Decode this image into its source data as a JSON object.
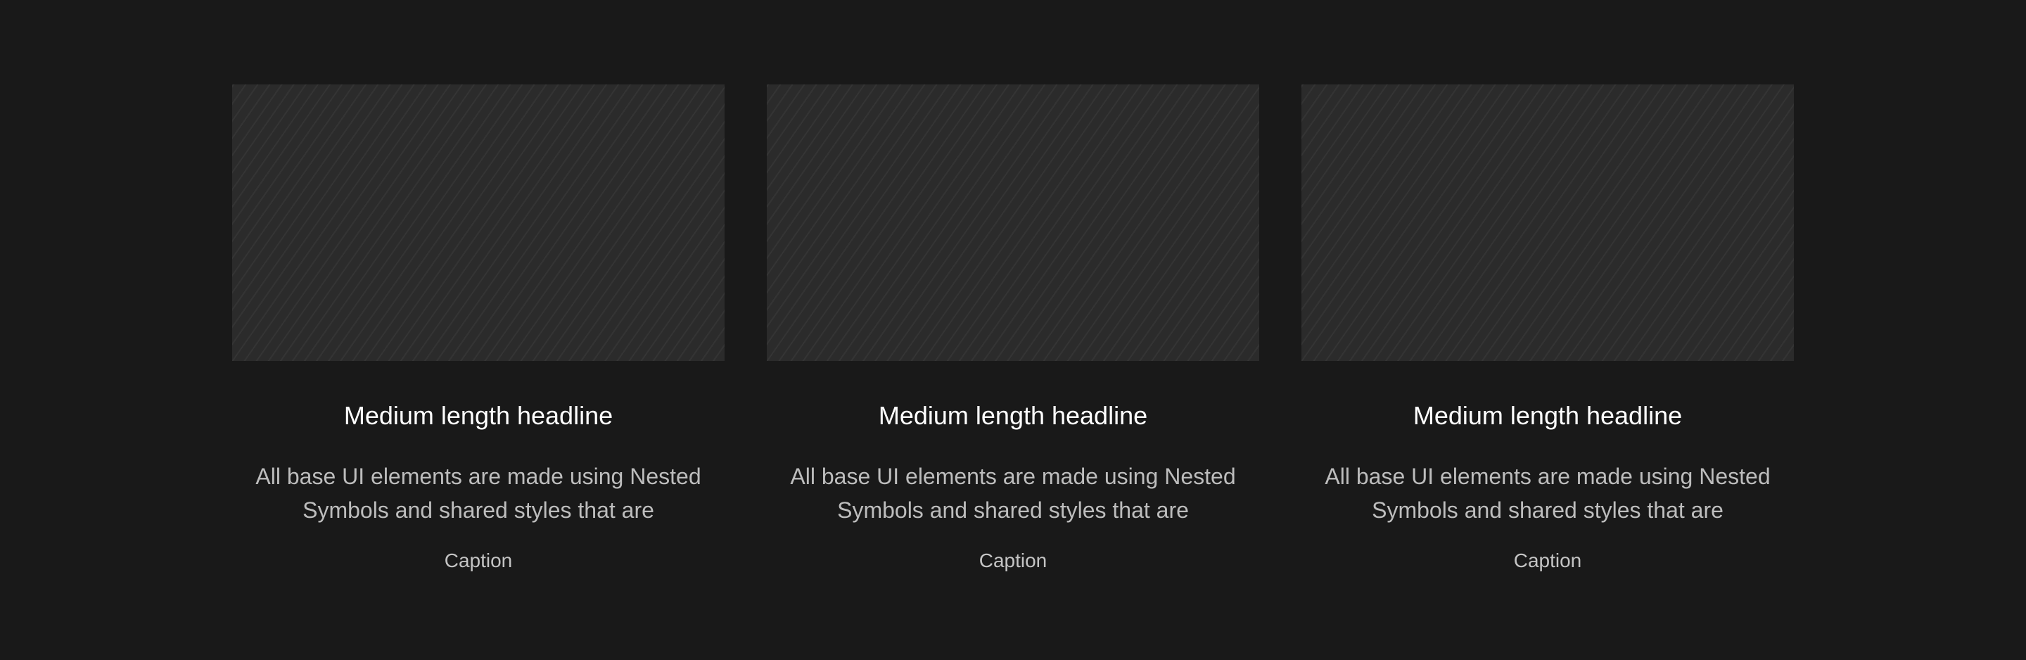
{
  "colors": {
    "background": "#191919",
    "placeholder": "#2b2b2b",
    "headline": "#ffffff",
    "body": "#bdbdbd",
    "caption": "#c4c4c4"
  },
  "cards": [
    {
      "image": "image-placeholder",
      "headline": "Medium length headline",
      "body": "All base UI elements are made using Nested Symbols and shared styles that are",
      "caption": "Caption"
    },
    {
      "image": "image-placeholder",
      "headline": "Medium length headline",
      "body": "All base UI elements are made using Nested Symbols and shared styles that are",
      "caption": "Caption"
    },
    {
      "image": "image-placeholder",
      "headline": "Medium length headline",
      "body": "All base UI elements are made using Nested Symbols and shared styles that are",
      "caption": "Caption"
    }
  ]
}
